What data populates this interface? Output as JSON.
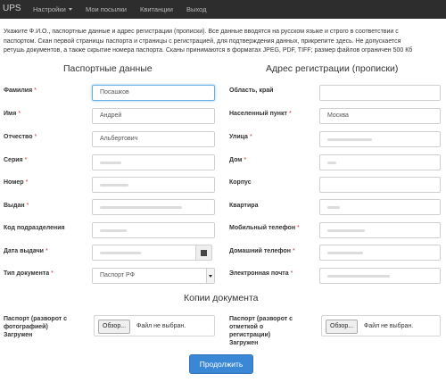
{
  "navbar": {
    "brand": "UPS",
    "items": [
      {
        "label": "Настройки",
        "has_caret": true
      },
      {
        "label": "Мои посылки"
      },
      {
        "label": "Квитанции"
      },
      {
        "label": "Выход"
      }
    ]
  },
  "intro": {
    "line1": "Укажите Ф.И.О., паспортные данные и адрес регистрации (прописки). Все данные вводятся на русском языке и строго в соответствии с",
    "line2": "паспортом. Скан первой страницы паспорта и страницы с регистрацией, для подтверждения данных, прикрепите здесь. Не допускается",
    "line3": "ретушь документов, а также скрытие номера паспорта. Сканы принимаются в форматах JPEG, PDF, TIFF; размер файлов ограничен 500 Кб"
  },
  "passport": {
    "title": "Паспортные данные",
    "fields": [
      {
        "label": "Фамилия",
        "required": true,
        "value": "Посашков"
      },
      {
        "label": "Имя",
        "required": true,
        "value": "Андрей"
      },
      {
        "label": "Отчество",
        "required": true,
        "value": "Альбертович"
      },
      {
        "label": "Серия",
        "required": true,
        "value": ""
      },
      {
        "label": "Номер",
        "required": true,
        "value": ""
      },
      {
        "label": "Выдан",
        "required": true,
        "value": ""
      },
      {
        "label": "Код подразделения",
        "required": false,
        "value": ""
      },
      {
        "label": "Дата выдачи",
        "required": true,
        "value": ""
      },
      {
        "label": "Тип документа",
        "required": true,
        "value": "Паспорт РФ"
      }
    ]
  },
  "address": {
    "title": "Адрес регистрации (прописки)",
    "fields": [
      {
        "label": "Область, край",
        "required": false,
        "value": ""
      },
      {
        "label": "Населенный пункт",
        "required": true,
        "value": "Москва"
      },
      {
        "label": "Улица",
        "required": true,
        "value": ""
      },
      {
        "label": "Дом",
        "required": true,
        "value": ""
      },
      {
        "label": "Корпус",
        "required": false,
        "value": ""
      },
      {
        "label": "Квартира",
        "required": false,
        "value": ""
      },
      {
        "label": "Мобильный телефон",
        "required": true,
        "value": ""
      },
      {
        "label": "Домашний телефон",
        "required": true,
        "value": ""
      },
      {
        "label": "Электронная почта",
        "required": true,
        "value": ""
      }
    ]
  },
  "copies": {
    "title": "Копии документа",
    "passport_upload": {
      "label_line1": "Паспорт (разворот с",
      "label_line2": "фотографией)",
      "status": "Загружен",
      "button": "Обзор...",
      "file_text": "Файл не выбран."
    },
    "registration_upload": {
      "label_line1": "Паспорт (разворот с",
      "label_line2": "отметкой о",
      "label_line3": "регистрации)",
      "status": "Загружен",
      "button": "Обзор...",
      "file_text": "Файл не выбран."
    }
  },
  "submit_label": "Продолжить",
  "required_mark": "*"
}
